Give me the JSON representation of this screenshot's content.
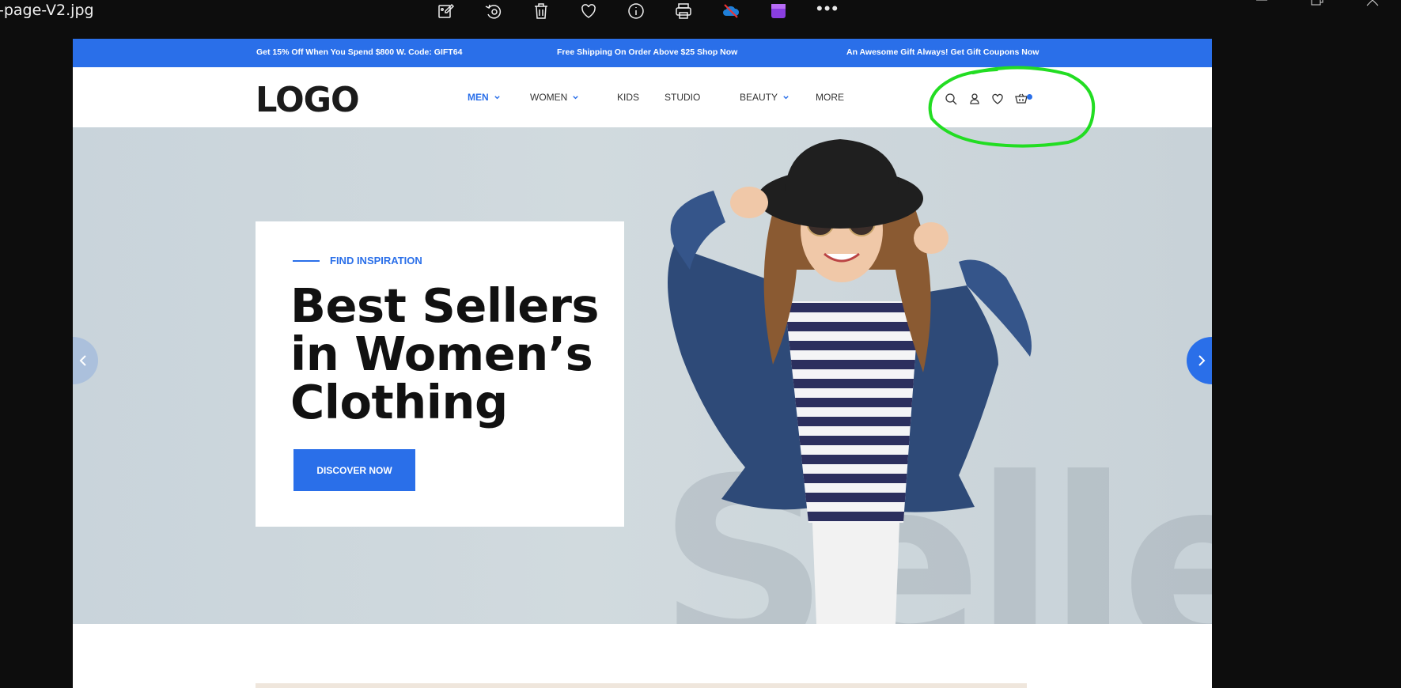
{
  "viewer": {
    "filename": "-page-V2.jpg",
    "toolbar": [
      "edit-image",
      "rotate",
      "delete",
      "favorite",
      "info",
      "print",
      "onedrive",
      "clipchamp",
      "more"
    ]
  },
  "promo": {
    "left": "Get 15% Off When You Spend $800 W. Code: GIFT64",
    "center": "Free Shipping On Order Above $25 Shop Now",
    "right": "An Awesome Gift Always! Get Gift Coupons Now"
  },
  "header": {
    "logo": "LOGO",
    "nav": [
      {
        "label": "MEN",
        "dropdown": true,
        "active": true
      },
      {
        "label": "WOMEN",
        "dropdown": true,
        "active": false
      },
      {
        "label": "KIDS",
        "dropdown": false,
        "active": false
      },
      {
        "label": "STUDIO",
        "dropdown": false,
        "active": false
      },
      {
        "label": "BEAUTY",
        "dropdown": true,
        "active": false
      },
      {
        "label": "MORE",
        "dropdown": false,
        "active": false
      }
    ],
    "icons": [
      "search-icon",
      "account-icon",
      "wishlist-icon",
      "cart-icon"
    ]
  },
  "hero": {
    "eyebrow": "FIND INSPIRATION",
    "headline_lines": [
      "Best Sellers",
      "in Women’s",
      "Clothing"
    ],
    "cta": "DISCOVER NOW",
    "watermark": "Selle"
  },
  "colors": {
    "accent": "#2a6fe9",
    "annotation": "#22dd22",
    "hero_bg": "#cdd6dc"
  }
}
